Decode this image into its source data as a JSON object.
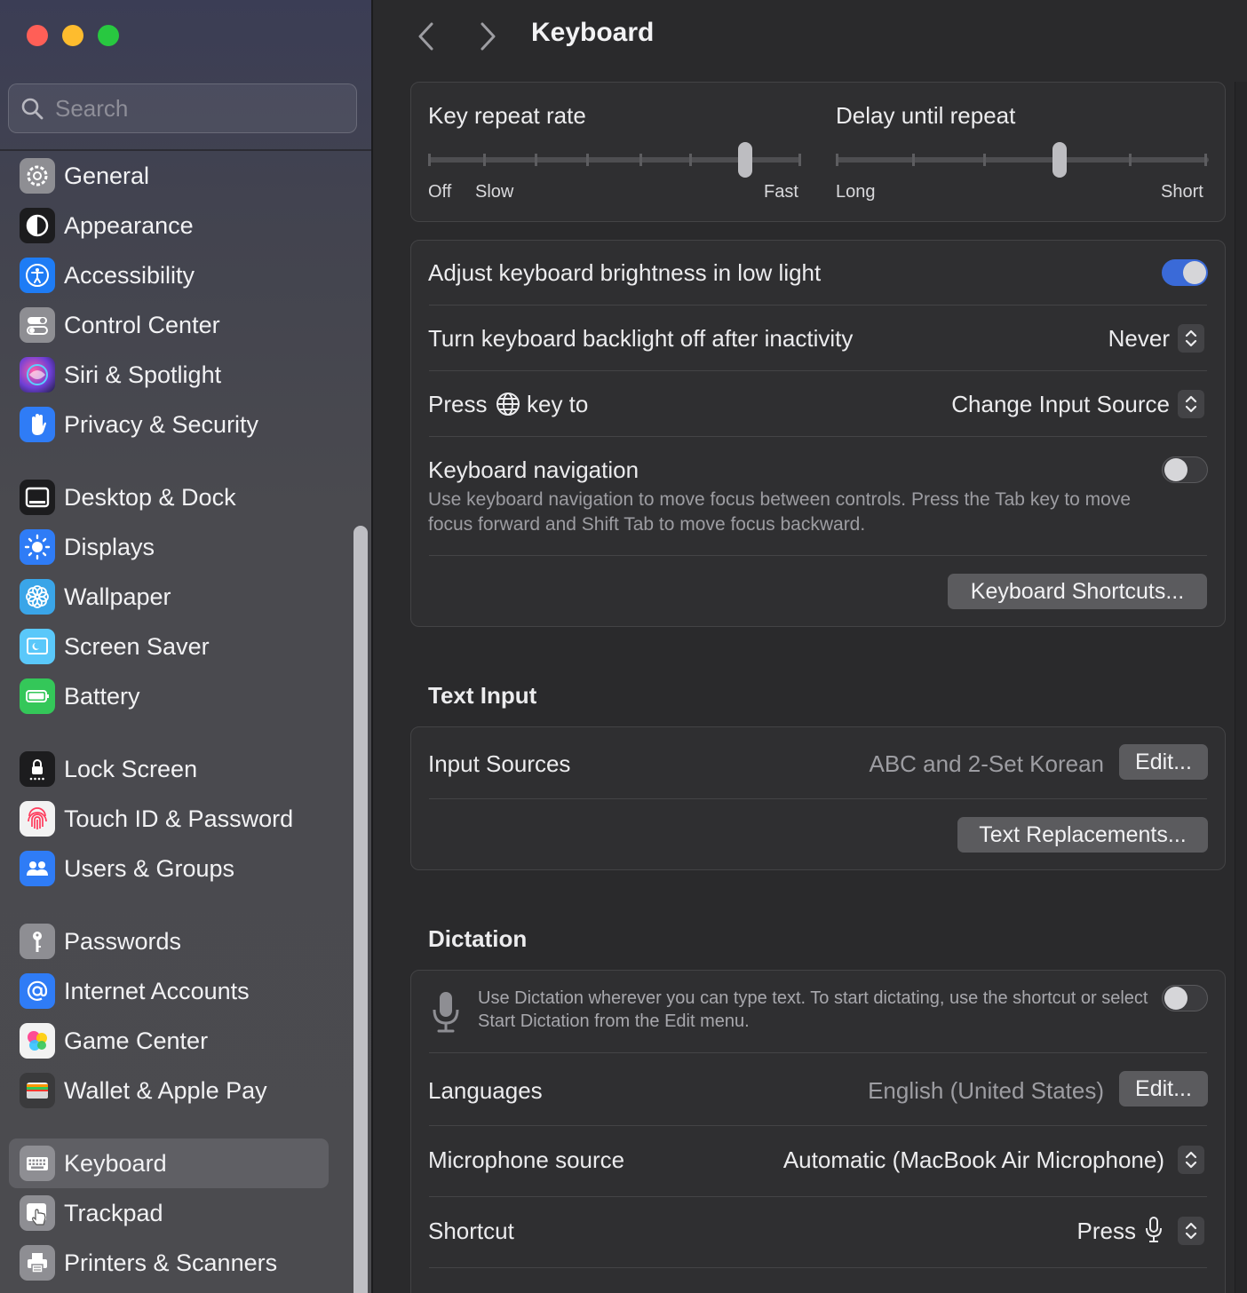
{
  "window": {
    "title": "Keyboard"
  },
  "sidebar": {
    "search_placeholder": "Search",
    "items": [
      {
        "label": "General",
        "icon": "gear-icon",
        "color": "#8e8e93"
      },
      {
        "label": "Appearance",
        "icon": "appearance-icon",
        "color": "#1c1c1e"
      },
      {
        "label": "Accessibility",
        "icon": "accessibility-icon",
        "color": "#1e7cf5"
      },
      {
        "label": "Control Center",
        "icon": "control-center-icon",
        "color": "#8e8e93"
      },
      {
        "label": "Siri & Spotlight",
        "icon": "siri-icon",
        "color": "#6e3fd6"
      },
      {
        "label": "Privacy & Security",
        "icon": "hand-icon",
        "color": "#2f7cf6"
      },
      {
        "label": "Desktop & Dock",
        "icon": "dock-icon",
        "color": "#1c1c1e"
      },
      {
        "label": "Displays",
        "icon": "sun-icon",
        "color": "#2f7cf6"
      },
      {
        "label": "Wallpaper",
        "icon": "flower-icon",
        "color": "#3aa5e8"
      },
      {
        "label": "Screen Saver",
        "icon": "screen-saver-icon",
        "color": "#5ac8fa"
      },
      {
        "label": "Battery",
        "icon": "battery-icon",
        "color": "#34c759"
      },
      {
        "label": "Lock Screen",
        "icon": "lock-icon",
        "color": "#1c1c1e"
      },
      {
        "label": "Touch ID & Password",
        "icon": "fingerprint-icon",
        "color": "#f2f2f2"
      },
      {
        "label": "Users & Groups",
        "icon": "users-icon",
        "color": "#2f7cf6"
      },
      {
        "label": "Passwords",
        "icon": "key-icon",
        "color": "#8e8e93"
      },
      {
        "label": "Internet Accounts",
        "icon": "at-icon",
        "color": "#2f7cf6"
      },
      {
        "label": "Game Center",
        "icon": "game-center-icon",
        "color": "#f2f2f2"
      },
      {
        "label": "Wallet & Apple Pay",
        "icon": "wallet-icon",
        "color": "#3a3a3c"
      },
      {
        "label": "Keyboard",
        "icon": "keyboard-icon",
        "color": "#8e8e93",
        "selected": true
      },
      {
        "label": "Trackpad",
        "icon": "trackpad-icon",
        "color": "#8e8e93"
      },
      {
        "label": "Printers & Scanners",
        "icon": "printer-icon",
        "color": "#8e8e93"
      }
    ]
  },
  "main": {
    "title": "Keyboard",
    "key_repeat": {
      "label": "Key repeat rate",
      "min_label_off": "Off",
      "min_label": "Slow",
      "max_label": "Fast",
      "value_fraction": 0.85
    },
    "delay_repeat": {
      "label": "Delay until repeat",
      "min_label": "Long",
      "max_label": "Short",
      "value_fraction": 0.6
    },
    "brightness": {
      "label": "Adjust keyboard brightness in low light",
      "on": true
    },
    "backlight": {
      "label": "Turn keyboard backlight off after inactivity",
      "value": "Never"
    },
    "globe_key": {
      "label_pre": "Press",
      "label_post": "key to",
      "value": "Change Input Source"
    },
    "keyboard_nav": {
      "label": "Keyboard navigation",
      "description": "Use keyboard navigation to move focus between controls. Press the Tab key to move focus forward and Shift Tab to move focus backward.",
      "on": false
    },
    "shortcuts_button": "Keyboard Shortcuts...",
    "text_input": {
      "heading": "Text Input",
      "input_sources_label": "Input Sources",
      "input_sources_value": "ABC and 2-Set Korean",
      "edit_button": "Edit...",
      "replacements_button": "Text Replacements..."
    },
    "dictation": {
      "heading": "Dictation",
      "description": "Use Dictation wherever you can type text. To start dictating, use the shortcut or select Start Dictation from the Edit menu.",
      "on": false,
      "languages_label": "Languages",
      "languages_value": "English (United States)",
      "languages_edit": "Edit...",
      "mic_label": "Microphone source",
      "mic_value": "Automatic (MacBook Air Microphone)",
      "shortcut_label": "Shortcut",
      "shortcut_value": "Press"
    }
  }
}
